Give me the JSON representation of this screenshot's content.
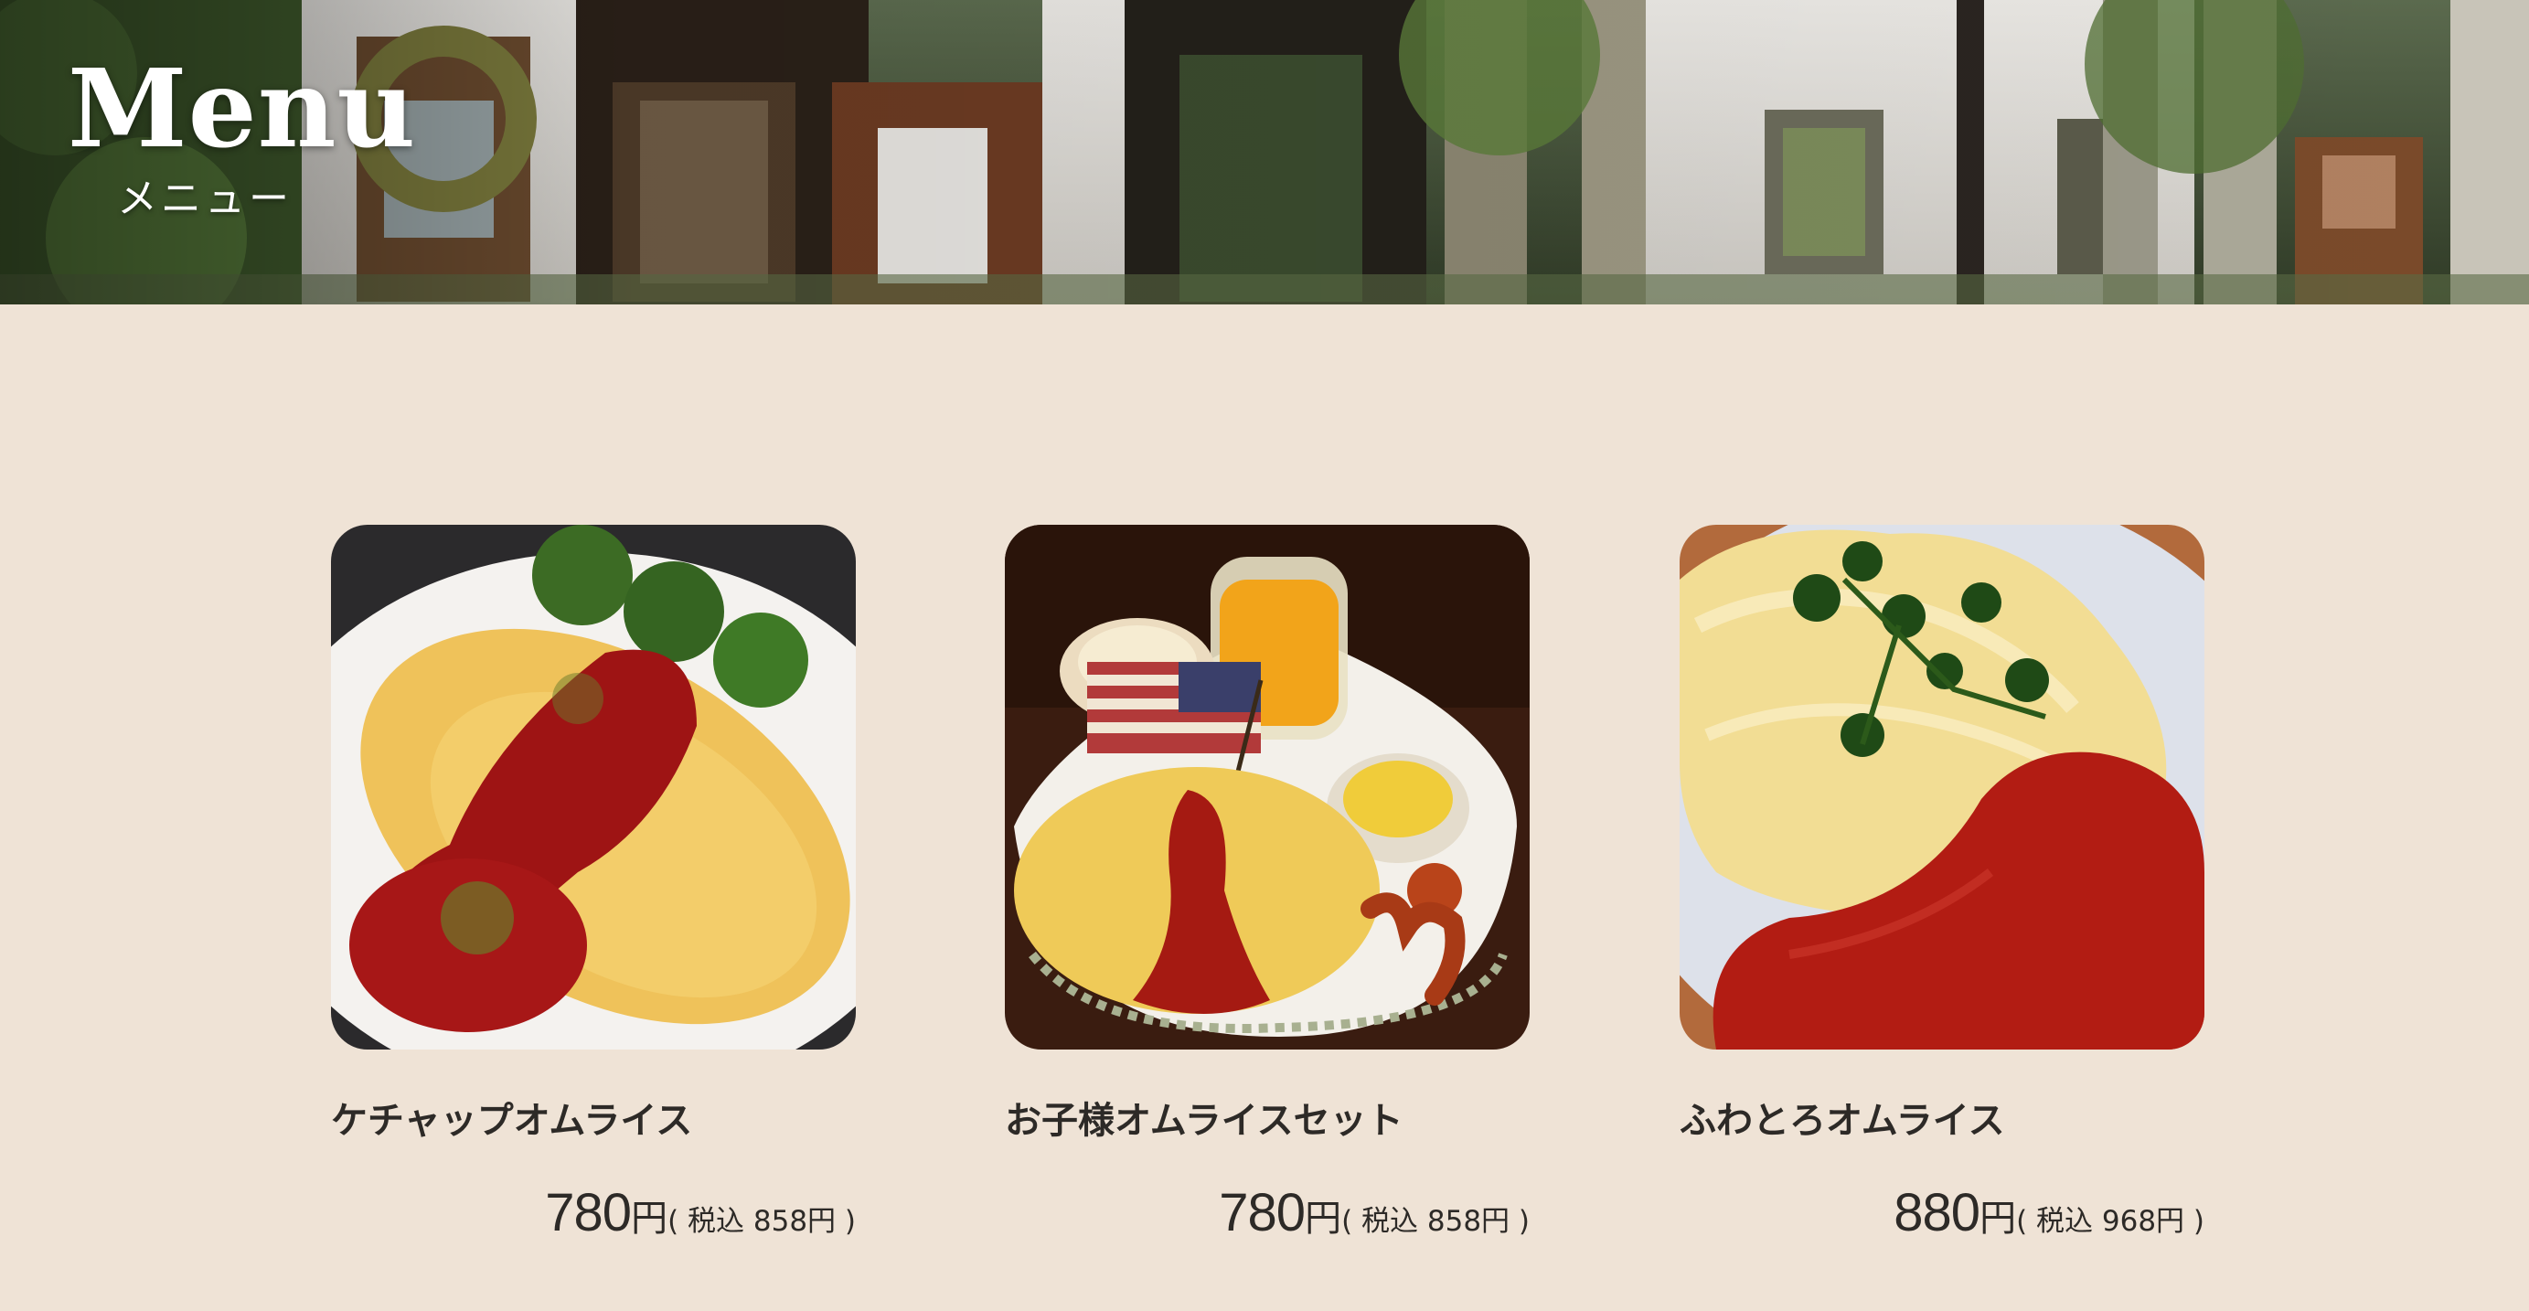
{
  "hero": {
    "title": "Menu",
    "subtitle": "メニュー",
    "image": "cafe-storefront-photo"
  },
  "menu": {
    "items": [
      {
        "name": "ケチャップオムライス",
        "price": "780",
        "yen": "円",
        "tax_note": "( 税込 858円 )",
        "image": "ketchup-omurice-photo"
      },
      {
        "name": "お子様オムライスセット",
        "price": "780",
        "yen": "円",
        "tax_note": "( 税込 858円 )",
        "image": "kids-omurice-set-photo"
      },
      {
        "name": "ふわとろオムライス",
        "price": "880",
        "yen": "円",
        "tax_note": "( 税込 968円 )",
        "image": "fluffy-omurice-photo"
      }
    ]
  },
  "colors": {
    "page_background": "#efe3d6",
    "text": "#2d2a27",
    "hero_text": "#ffffff"
  }
}
